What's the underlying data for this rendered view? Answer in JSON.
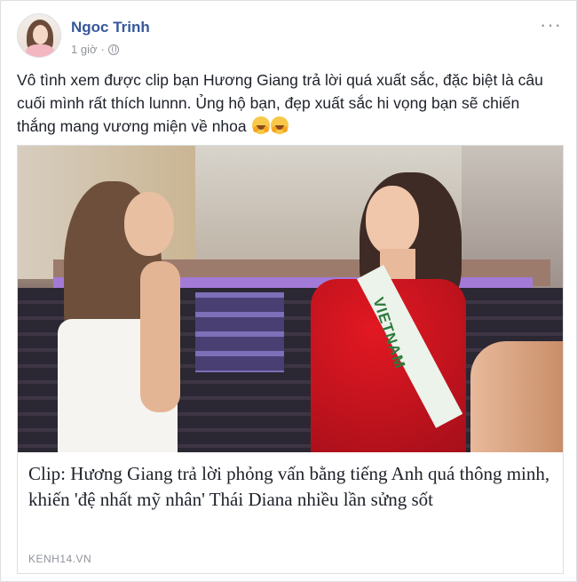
{
  "post": {
    "author": "Ngoc Trinh",
    "time": "1 giờ",
    "separator": "·",
    "privacy_icon": "globe-icon",
    "text": "Vô tình xem được clip bạn Hương Giang trả lời quá xuất sắc, đặc biệt là câu cuối mình rất thích lunnn. Ủng hộ bạn, đẹp xuất sắc hi vọng bạn sẽ chiến thắng mang vương miện về nhoa",
    "emojis": [
      "hugging-face-emoji",
      "hugging-face-emoji"
    ],
    "more_label": "···"
  },
  "link_preview": {
    "image_sash_text": "VIETNAM",
    "title": "Clip: Hương Giang trả lời phỏng vấn bằng tiếng Anh quá thông minh, khiến 'đệ nhất mỹ nhân' Thái Diana nhiều lần sửng sốt",
    "domain": "KENH14.VN"
  },
  "colors": {
    "author_link": "#365899",
    "text": "#1d2129",
    "meta": "#90949c",
    "border": "#dddfe2"
  }
}
